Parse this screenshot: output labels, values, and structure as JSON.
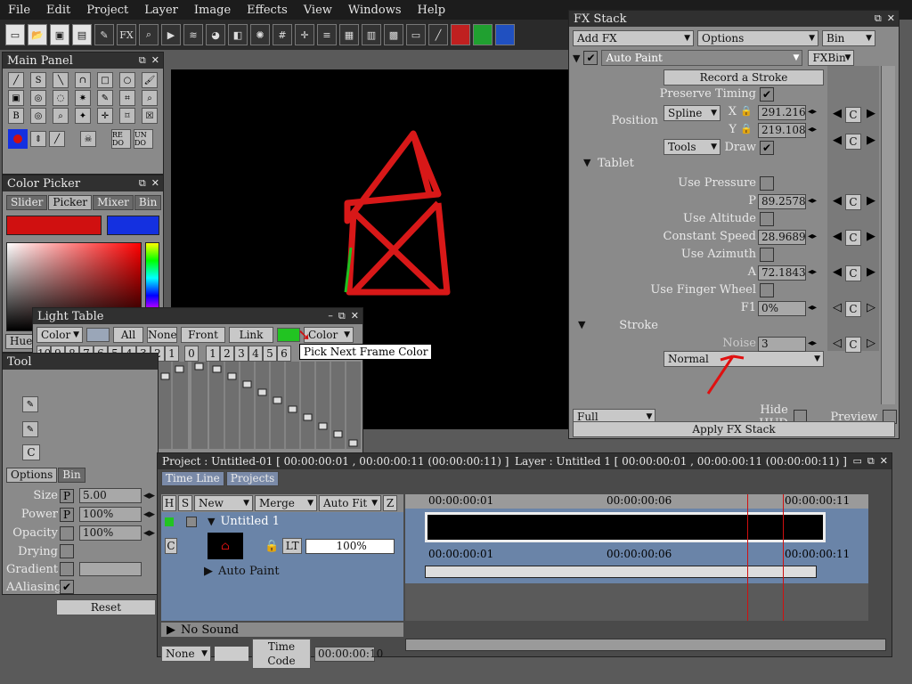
{
  "menu": [
    "File",
    "Edit",
    "Project",
    "Layer",
    "Image",
    "Effects",
    "View",
    "Windows",
    "Help"
  ],
  "toolbar": {
    "fx_label": "FX"
  },
  "main_panel": {
    "title": "Main Panel",
    "undo1": "RE DO",
    "undo2": "UN DO"
  },
  "color_picker": {
    "title": "Color Picker",
    "tabs": [
      "Slider",
      "Picker",
      "Mixer",
      "Bin"
    ],
    "primary_color": "#d01010",
    "secondary_color": "#1430e0",
    "hue_label": "Hue"
  },
  "light_table": {
    "title": "Light Table",
    "color_sel": "Color",
    "btn_all": "All",
    "btn_none": "None",
    "btn_front": "Front",
    "btn_link": "Link",
    "color_sel2": "Color",
    "left_nums": [
      "10",
      "9",
      "8",
      "7",
      "6",
      "5",
      "4",
      "3",
      "2",
      "1",
      "0"
    ],
    "right_nums": [
      "1",
      "2",
      "3",
      "4",
      "5",
      "6"
    ],
    "tooltip": "Pick Next Frame Color",
    "frame_color": "#22c422"
  },
  "tool_panel": {
    "title": "Tool",
    "c_label": "C",
    "options_tab": "Options",
    "bin_tab": "Bin",
    "size_label": "Size",
    "size_value": "5.00",
    "power_label": "Power",
    "power_value": "100%",
    "opacity_label": "Opacity",
    "opacity_value": "100%",
    "drying_label": "Drying",
    "gradient_label": "Gradient",
    "aalias_label": "AAliasing",
    "reset_label": "Reset",
    "p_mark": "P"
  },
  "fx_stack": {
    "title": "FX Stack",
    "add_fx": "Add FX",
    "options": "Options",
    "bin": "Bin",
    "effect_name": "Auto Paint",
    "fxbin": "FXBin",
    "record_btn": "Record a Stroke",
    "preserve_timing": "Preserve Timing",
    "position_label": "Position",
    "spline_sel": "Spline",
    "tools_sel": "Tools",
    "x_label": "X",
    "x_value": "291.216",
    "y_label": "Y",
    "y_value": "219.108",
    "draw_label": "Draw",
    "tablet_label": "Tablet",
    "use_pressure": "Use Pressure",
    "p_label": "P",
    "p_value": "89.2578",
    "use_altitude": "Use Altitude",
    "const_speed": "Constant Speed",
    "const_speed_value": "28.9689",
    "use_azimuth": "Use Azimuth",
    "a_label": "A",
    "a_value": "72.1843",
    "use_finger": "Use Finger Wheel",
    "f1_label": "F1",
    "f1_value": "0%",
    "stroke_label": "Stroke",
    "stroke_value": "Normal",
    "noise_label": "Noise",
    "noise_value": "3",
    "c_btn": "C",
    "full_sel": "Full",
    "hide_hud": "Hide HUD",
    "preview": "Preview",
    "apply": "Apply FX Stack"
  },
  "timeline": {
    "project_title": "Project : Untitled-01 [ 00:00:00:01 , 00:00:00:11 (00:00:00:11) ]",
    "layer_title": "Layer : Untitled 1 [ 00:00:00:01 , 00:00:00:11 (00:00:00:11) ]",
    "tab_timeline": "Time Line",
    "tab_projects": "Projects",
    "col_h": "H",
    "col_s": "S",
    "new_sel": "New",
    "merge_sel": "Merge",
    "autofit_sel": "Auto Fit",
    "col_z": "Z",
    "layer_name": "Untitled 1",
    "lt_label": "LT",
    "opacity": "100%",
    "autopaint_row": "Auto Paint",
    "no_sound": "No Sound",
    "none_sel": "None",
    "timecode_label": "Time Code",
    "timecode_value": "00:00:00:10",
    "ruler": [
      "00:00:00:01",
      "00:00:00:06",
      "00:00:00:11"
    ],
    "c_mark": "C"
  }
}
